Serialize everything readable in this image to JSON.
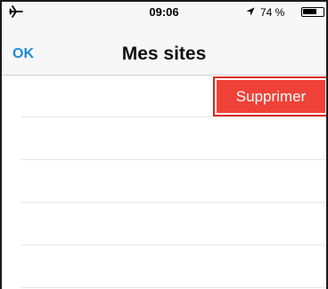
{
  "status_bar": {
    "time": "09:06",
    "battery_text": "74 %",
    "battery_level": 0.74,
    "icons": [
      "airplane-icon",
      "location-arrow-icon",
      "battery-icon"
    ]
  },
  "nav": {
    "ok_label": "OK",
    "title": "Mes sites"
  },
  "list": {
    "delete_label": "Supprimer",
    "row_count": 5
  },
  "colors": {
    "accent": "#1f8ad6",
    "delete": "#ef4138",
    "highlight": "#e2231a"
  }
}
